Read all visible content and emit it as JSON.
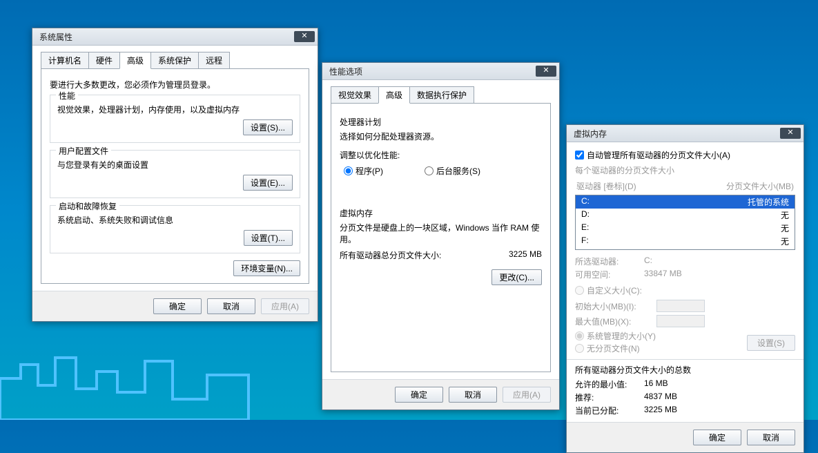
{
  "bg": {},
  "sysprops": {
    "title": "系统属性",
    "tabs": {
      "computerName": "计算机名",
      "hardware": "硬件",
      "advanced": "高级",
      "systemProtection": "系统保护",
      "remote": "远程"
    },
    "admin_notice": "要进行大多数更改，您必须作为管理员登录。",
    "perf": {
      "legend": "性能",
      "desc": "视觉效果，处理器计划，内存使用，以及虚拟内存",
      "settings_btn": "设置(S)..."
    },
    "profiles": {
      "legend": "用户配置文件",
      "desc": "与您登录有关的桌面设置",
      "settings_btn": "设置(E)..."
    },
    "startup": {
      "legend": "启动和故障恢复",
      "desc": "系统启动、系统失败和调试信息",
      "settings_btn": "设置(T)..."
    },
    "env_btn": "环境变量(N)...",
    "ok": "确定",
    "cancel": "取消",
    "apply": "应用(A)"
  },
  "perfopts": {
    "title": "性能选项",
    "tabs": {
      "visualEffects": "视觉效果",
      "advanced": "高级",
      "dep": "数据执行保护"
    },
    "scheduler": {
      "legend": "处理器计划",
      "desc": "选择如何分配处理器资源。",
      "adjust_label": "调整以优化性能:",
      "programs": "程序(P)",
      "background": "后台服务(S)"
    },
    "vm": {
      "legend": "虚拟内存",
      "desc1": "分页文件是硬盘上的一块区域，Windows 当作 RAM 使用。",
      "total_label": "所有驱动器总分页文件大小:",
      "total_value": "3225 MB",
      "change_btn": "更改(C)..."
    },
    "ok": "确定",
    "cancel": "取消",
    "apply": "应用(A)"
  },
  "vmem": {
    "title": "虚拟内存",
    "autoManage": "自动管理所有驱动器的分页文件大小(A)",
    "perDrive": "每个驱动器的分页文件大小",
    "cols": {
      "drive": "驱动器 [卷标](D)",
      "size": "分页文件大小(MB)"
    },
    "drives": [
      {
        "d": "C:",
        "v": "托管的系统",
        "selected": true
      },
      {
        "d": "D:",
        "v": "无"
      },
      {
        "d": "E:",
        "v": "无"
      },
      {
        "d": "F:",
        "v": "无"
      }
    ],
    "selectedDriveLabel": "所选驱动器:",
    "selectedDriveValue": "C:",
    "availSpaceLabel": "可用空间:",
    "availSpaceValue": "33847 MB",
    "customSize": "自定义大小(C):",
    "initialLabel": "初始大小(MB)(I):",
    "maxLabel": "最大值(MB)(X):",
    "systemManaged": "系统管理的大小(Y)",
    "noPageFile": "无分页文件(N)",
    "setBtn": "设置(S)",
    "totalsLegend": "所有驱动器分页文件大小的总数",
    "minAllowedLabel": "允许的最小值:",
    "minAllowedValue": "16 MB",
    "recommendedLabel": "推荐:",
    "recommendedValue": "4837 MB",
    "currentAllocLabel": "当前已分配:",
    "currentAllocValue": "3225 MB",
    "ok": "确定",
    "cancel": "取消"
  }
}
